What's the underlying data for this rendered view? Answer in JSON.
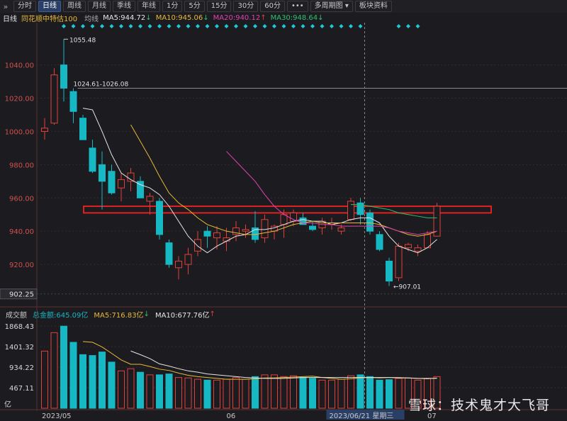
{
  "toolbar": {
    "nav_icon": "double-chevron-right-icon",
    "tabs": [
      "分时",
      "日线",
      "周线",
      "月线",
      "季线",
      "年线",
      "1分",
      "5分",
      "15分",
      "30分",
      "60分",
      "•••",
      "多周期图 ▾",
      "板块资料"
    ],
    "active": 1
  },
  "legend": {
    "period": "日线",
    "index_name": "同花顺中特估100",
    "ma_label": "均线",
    "ma5": "MA5:944.72",
    "ma10": "MA10:945.06",
    "ma20": "MA20:940.12",
    "ma30": "MA30:948.64"
  },
  "volume_legend": {
    "title": "成交额",
    "total": "总金额:645.09亿",
    "ma5": "MA5:716.83亿",
    "ma10": "MA10:677.76亿"
  },
  "colors": {
    "up": "#e0403a",
    "down": "#16b8c4",
    "ma5": "#e6e6e6",
    "ma10": "#e6b83a",
    "ma20": "#e040b0",
    "ma30": "#2cc06e",
    "grid": "#3a2a2a",
    "highlight": "#e02020"
  },
  "chart_data": {
    "type": "candlestick",
    "price_axis": {
      "ticks": [
        920,
        940,
        960,
        980,
        1000,
        1020,
        1040
      ],
      "ylim": [
        900,
        1062
      ],
      "last_price_label": "902.25"
    },
    "volume_axis": {
      "ticks": [
        467.11,
        934.22,
        1401.32,
        1868.43
      ],
      "unit": "亿",
      "ylim": [
        0,
        2000
      ]
    },
    "x_labels": [
      {
        "index": 0,
        "text": "2023/05"
      },
      {
        "index": 19,
        "text": "06"
      },
      {
        "index": 33,
        "text": "2023/06/21 星期三"
      },
      {
        "index": 40,
        "text": "07"
      }
    ],
    "candles": [
      {
        "o": 1000,
        "h": 1008,
        "l": 995,
        "c": 1002
      },
      {
        "o": 1005,
        "h": 1038,
        "l": 1004,
        "c": 1034
      },
      {
        "o": 1040,
        "h": 1055.48,
        "l": 1018,
        "c": 1026
      },
      {
        "o": 1024,
        "h": 1026,
        "l": 1005,
        "c": 1012
      },
      {
        "o": 1008,
        "h": 1010,
        "l": 995,
        "c": 995
      },
      {
        "o": 990,
        "h": 995,
        "l": 975,
        "c": 976
      },
      {
        "o": 980,
        "h": 988,
        "l": 953,
        "c": 970
      },
      {
        "o": 976,
        "h": 980,
        "l": 962,
        "c": 963
      },
      {
        "o": 966,
        "h": 975,
        "l": 958,
        "c": 971
      },
      {
        "o": 970,
        "h": 978,
        "l": 964,
        "c": 975
      },
      {
        "o": 970,
        "h": 973,
        "l": 960,
        "c": 960
      },
      {
        "o": 958,
        "h": 963,
        "l": 950,
        "c": 961
      },
      {
        "o": 958,
        "h": 960,
        "l": 935,
        "c": 938
      },
      {
        "o": 933,
        "h": 935,
        "l": 918,
        "c": 920
      },
      {
        "o": 918,
        "h": 925,
        "l": 911,
        "c": 922
      },
      {
        "o": 920,
        "h": 930,
        "l": 914,
        "c": 926
      },
      {
        "o": 928,
        "h": 940,
        "l": 925,
        "c": 935
      },
      {
        "o": 940,
        "h": 943,
        "l": 930,
        "c": 937
      },
      {
        "o": 936,
        "h": 943,
        "l": 929,
        "c": 939
      },
      {
        "o": 934,
        "h": 942,
        "l": 928,
        "c": 936
      },
      {
        "o": 938,
        "h": 946,
        "l": 934,
        "c": 942
      },
      {
        "o": 940,
        "h": 944,
        "l": 936,
        "c": 941
      },
      {
        "o": 942,
        "h": 952,
        "l": 933,
        "c": 935
      },
      {
        "o": 936,
        "h": 950,
        "l": 933,
        "c": 947
      },
      {
        "o": 940,
        "h": 944,
        "l": 935,
        "c": 943
      },
      {
        "o": 944,
        "h": 953,
        "l": 936,
        "c": 950
      },
      {
        "o": 946,
        "h": 953,
        "l": 943,
        "c": 951
      },
      {
        "o": 948,
        "h": 951,
        "l": 944,
        "c": 944
      },
      {
        "o": 943,
        "h": 946,
        "l": 940,
        "c": 941
      },
      {
        "o": 942,
        "h": 948,
        "l": 938,
        "c": 946
      },
      {
        "o": 944,
        "h": 948,
        "l": 941,
        "c": 945
      },
      {
        "o": 940,
        "h": 944,
        "l": 938,
        "c": 942
      },
      {
        "o": 947,
        "h": 960,
        "l": 946,
        "c": 958
      },
      {
        "o": 957,
        "h": 960,
        "l": 944,
        "c": 950
      },
      {
        "o": 951,
        "h": 953,
        "l": 938,
        "c": 940
      },
      {
        "o": 938,
        "h": 940,
        "l": 928,
        "c": 929
      },
      {
        "o": 922,
        "h": 924,
        "l": 907.01,
        "c": 910
      },
      {
        "o": 912,
        "h": 933,
        "l": 910,
        "c": 931
      },
      {
        "o": 930,
        "h": 933,
        "l": 928,
        "c": 932
      },
      {
        "o": 928,
        "h": 932,
        "l": 925,
        "c": 930
      },
      {
        "o": 930,
        "h": 940,
        "l": 930,
        "c": 938
      },
      {
        "o": 937,
        "h": 957,
        "l": 937,
        "c": 955
      }
    ],
    "volumes": [
      1300,
      1720,
      1868.43,
      1500,
      1220,
      1200,
      1280,
      1050,
      850,
      900,
      820,
      760,
      760,
      780,
      700,
      690,
      660,
      640,
      640,
      660,
      700,
      660,
      720,
      760,
      760,
      720,
      740,
      700,
      680,
      640,
      640,
      660,
      740,
      760,
      720,
      640,
      650,
      680,
      690,
      640,
      680,
      720
    ],
    "ma5": [
      null,
      null,
      null,
      null,
      1014,
      1013,
      1000,
      986,
      975,
      971,
      968,
      966,
      962,
      955,
      946,
      937,
      931,
      927,
      931,
      934,
      937,
      938,
      941,
      941,
      942,
      944,
      946,
      947,
      946,
      946,
      944,
      945,
      947,
      948,
      948,
      945,
      937,
      931,
      929,
      927,
      930,
      935
    ],
    "ma10": [
      null,
      null,
      null,
      null,
      null,
      null,
      null,
      null,
      null,
      1004,
      994,
      984,
      973,
      963,
      957,
      953,
      948,
      944,
      942,
      940,
      939,
      938,
      938,
      939,
      940,
      942,
      944,
      945,
      946,
      945,
      945,
      945,
      945,
      945,
      945,
      944,
      942,
      940,
      938,
      937,
      938,
      940
    ],
    "ma20": [
      null,
      null,
      null,
      null,
      null,
      null,
      null,
      null,
      null,
      null,
      null,
      null,
      null,
      null,
      null,
      null,
      null,
      null,
      null,
      988,
      982,
      976,
      970,
      962,
      955,
      950,
      947,
      945,
      945,
      944,
      944,
      943,
      943,
      943,
      943,
      943,
      942,
      940,
      939,
      938,
      939,
      940
    ],
    "ma30": [
      null,
      null,
      null,
      null,
      null,
      null,
      null,
      null,
      null,
      null,
      null,
      null,
      null,
      null,
      null,
      null,
      null,
      null,
      null,
      null,
      null,
      null,
      null,
      null,
      null,
      null,
      null,
      null,
      null,
      null,
      null,
      null,
      956,
      956,
      955,
      954,
      953,
      951,
      950,
      949,
      948,
      948
    ],
    "vol_ma5": [
      null,
      null,
      null,
      null,
      1518,
      1502,
      1394,
      1250,
      1100,
      1000,
      1000,
      950,
      890,
      860,
      800,
      750,
      720,
      700,
      680,
      660,
      660,
      660,
      670,
      690,
      690,
      700,
      710,
      720,
      730,
      700,
      680,
      660,
      670,
      690,
      700,
      690,
      700,
      700,
      690,
      680,
      670,
      690
    ],
    "vol_ma10": [
      null,
      null,
      null,
      null,
      null,
      null,
      null,
      null,
      null,
      1302,
      1220,
      1130,
      1010,
      960,
      900,
      850,
      820,
      780,
      760,
      740,
      720,
      700,
      690,
      680,
      680,
      680,
      690,
      700,
      700,
      700,
      700,
      700,
      700,
      700,
      700,
      700,
      700,
      690,
      690,
      680,
      680,
      680
    ],
    "annotations": {
      "high_label": "1055.48",
      "range_label": "1024.61-1026.08",
      "low_label": "907.01",
      "zone": [
        951,
        955
      ]
    }
  },
  "watermark": "雪球：技术鬼才大飞哥"
}
